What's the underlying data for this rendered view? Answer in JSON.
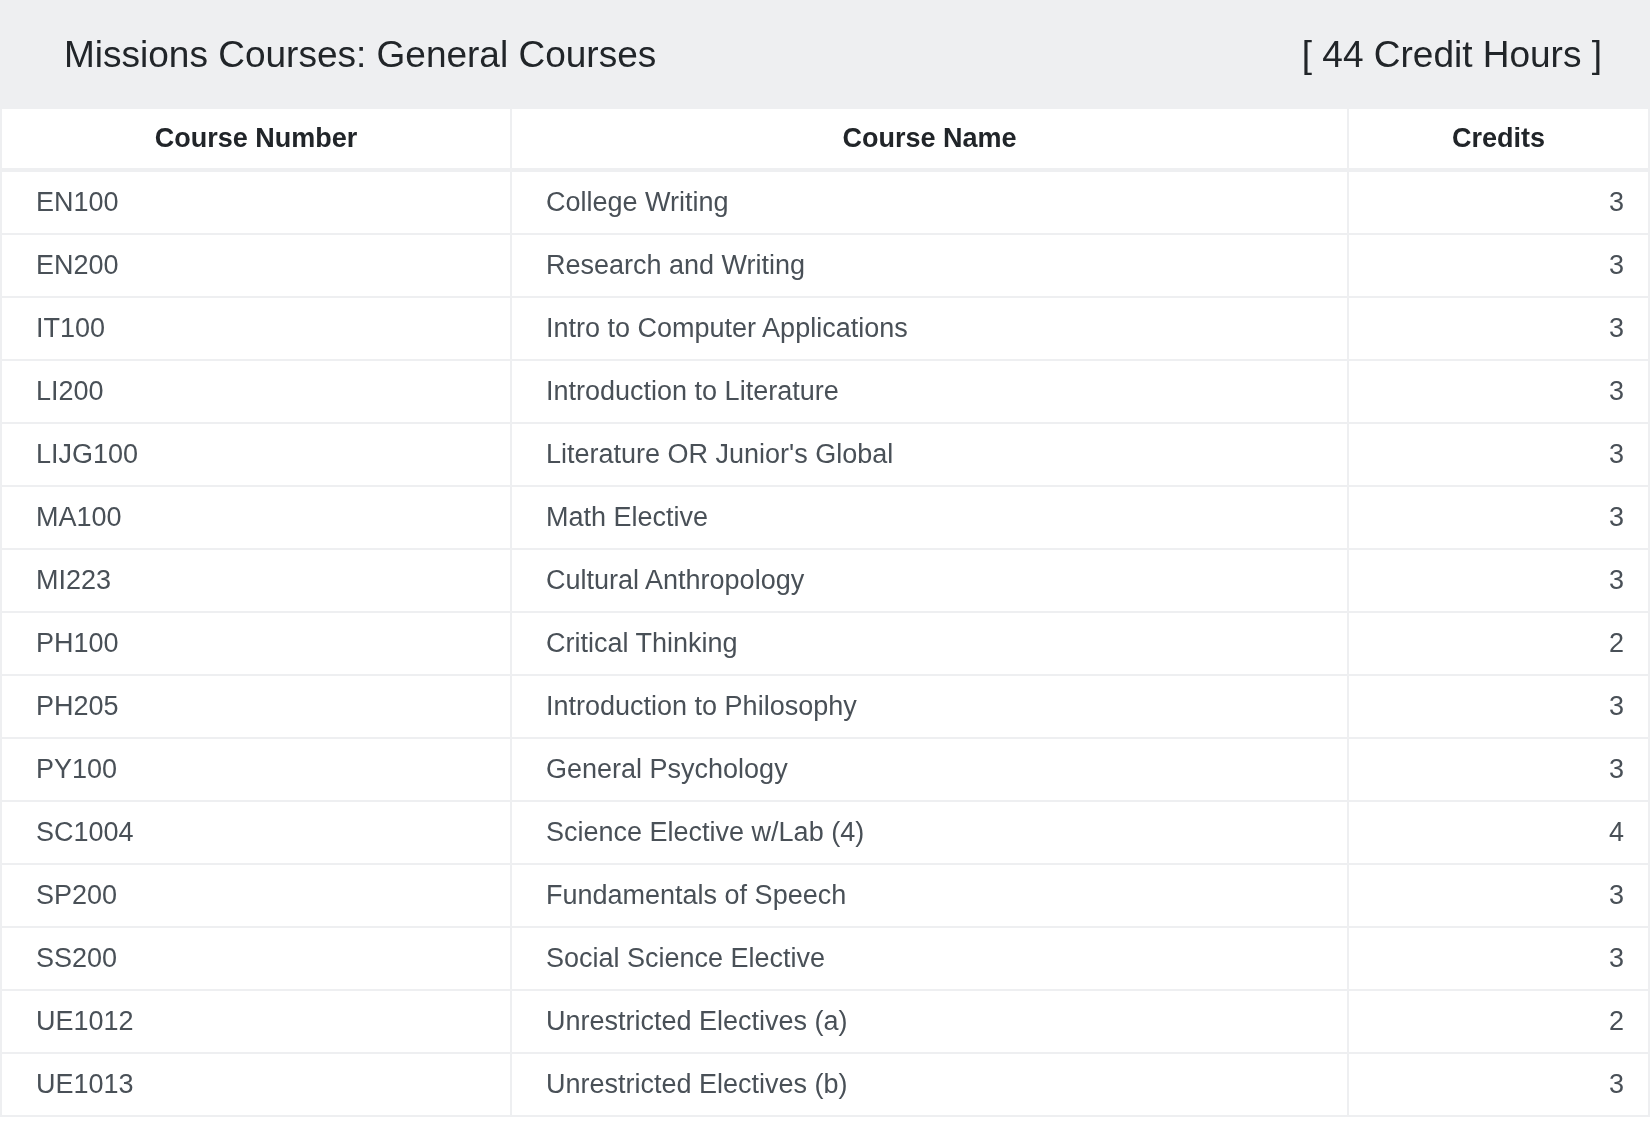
{
  "header": {
    "title": "Missions Courses: General Courses",
    "credit_hours": "[ 44 Credit Hours ]"
  },
  "table": {
    "columns": [
      "Course Number",
      "Course Name",
      "Credits"
    ],
    "rows": [
      [
        "EN100",
        "College Writing",
        "3"
      ],
      [
        "EN200",
        "Research and Writing",
        "3"
      ],
      [
        "IT100",
        "Intro to Computer Applications",
        "3"
      ],
      [
        "LI200",
        "Introduction to Literature",
        "3"
      ],
      [
        "LIJG100",
        "Literature OR Junior's Global",
        "3"
      ],
      [
        "MA100",
        "Math Elective",
        "3"
      ],
      [
        "MI223",
        "Cultural Anthropology",
        "3"
      ],
      [
        "PH100",
        "Critical Thinking",
        "2"
      ],
      [
        "PH205",
        "Introduction to Philosophy",
        "3"
      ],
      [
        "PY100",
        "General Psychology",
        "3"
      ],
      [
        "SC1004",
        "Science Elective w/Lab (4)",
        "4"
      ],
      [
        "SP200",
        "Fundamentals of Speech",
        "3"
      ],
      [
        "SS200",
        "Social Science Elective",
        "3"
      ],
      [
        "UE1012",
        "Unrestricted Electives (a)",
        "2"
      ],
      [
        "UE1013",
        "Unrestricted Electives (b)",
        "3"
      ]
    ]
  }
}
